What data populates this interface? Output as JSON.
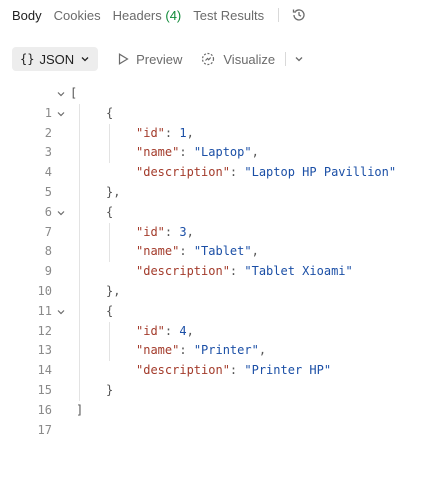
{
  "tabs": [
    {
      "label": "Body",
      "active": true
    },
    {
      "label": "Cookies",
      "active": false
    },
    {
      "label": "Headers",
      "count": "(4)",
      "active": false
    },
    {
      "label": "Test Results",
      "active": false
    }
  ],
  "toolbar": {
    "format": "JSON",
    "format_braces": "{}",
    "preview_label": "Preview",
    "visualize_label": "Visualize"
  },
  "code": {
    "line_numbers": [
      "1",
      "2",
      "3",
      "4",
      "5",
      "6",
      "7",
      "8",
      "9",
      "10",
      "11",
      "12",
      "13",
      "14",
      "15",
      "16",
      "17"
    ],
    "open_bracket": "[",
    "close_bracket": "]",
    "open_brace": "{",
    "close_brace": "}",
    "close_brace_comma": "},",
    "keys": {
      "id": "\"id\"",
      "name": "\"name\"",
      "description": "\"description\""
    },
    "items": [
      {
        "id": "1",
        "name": "\"Laptop\"",
        "description": "\"Laptop HP Pavillion\""
      },
      {
        "id": "3",
        "name": "\"Tablet\"",
        "description": "\"Tablet Xioami\""
      },
      {
        "id": "4",
        "name": "\"Printer\"",
        "description": "\"Printer HP\""
      }
    ]
  },
  "colors": {
    "key": "#a33b2b",
    "string": "#1b4fa6",
    "number": "#1b4fa6",
    "count_badge": "#0f8a38"
  }
}
